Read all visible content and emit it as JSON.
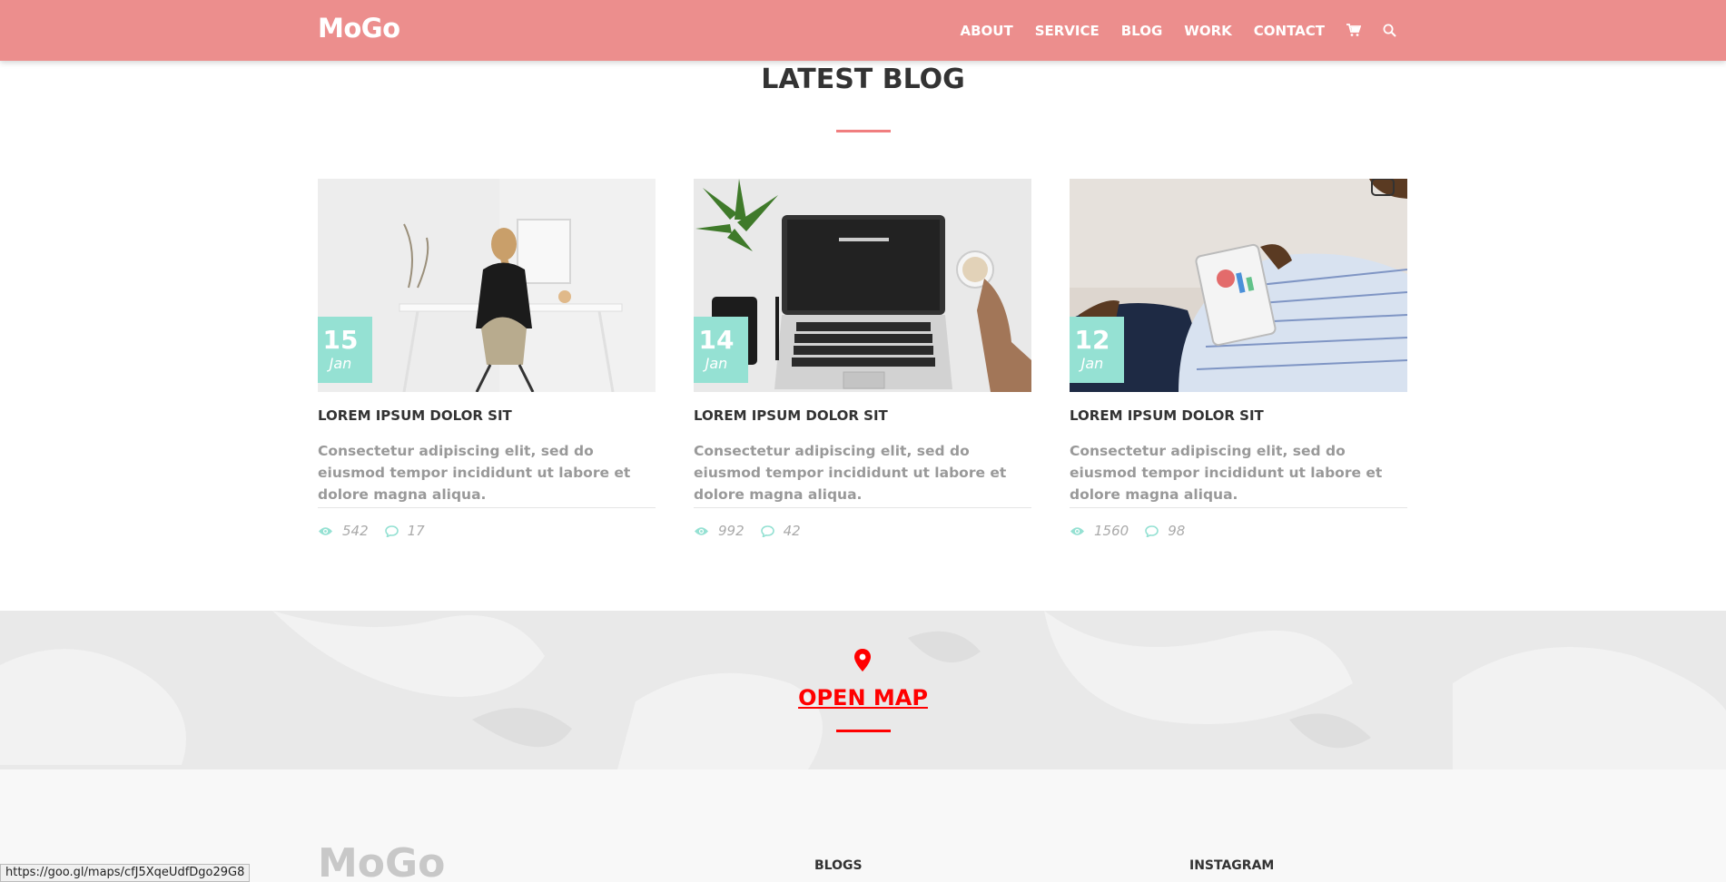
{
  "header": {
    "logo": "MoGo",
    "nav": [
      "ABOUT",
      "SERVICE",
      "BLOG",
      "WORK",
      "CONTACT"
    ],
    "icons": [
      "cart-icon",
      "search-icon"
    ]
  },
  "blog": {
    "title": "LATEST BLOG",
    "posts": [
      {
        "day": "15",
        "month": "Jan",
        "title": "LOREM IPSUM DOLOR SIT",
        "text": "Consectetur adipiscing elit, sed do eiusmod tempor incididunt ut labore et dolore magna aliqua.",
        "views": "542",
        "comments": "17"
      },
      {
        "day": "14",
        "month": "Jan",
        "title": "LOREM IPSUM DOLOR SIT",
        "text": "Consectetur adipiscing elit, sed do eiusmod tempor incididunt ut labore et dolore magna aliqua.",
        "views": "992",
        "comments": "42"
      },
      {
        "day": "12",
        "month": "Jan",
        "title": "LOREM IPSUM DOLOR SIT",
        "text": "Consectetur adipiscing elit, sed do eiusmod tempor incididunt ut labore et dolore magna aliqua.",
        "views": "1560",
        "comments": "98"
      }
    ]
  },
  "map": {
    "link": "OPEN MAP"
  },
  "footer": {
    "logo": "MoGo",
    "blogs": "BLOGS",
    "instagram": "INSTAGRAM"
  },
  "status_url": "https://goo.gl/maps/cfJ5XqeUdfDgo29G8",
  "colors": {
    "header": "#ec8e8d",
    "accent": "#95e1d3",
    "map_link": "#ff0000",
    "rule": "#f07e7f"
  }
}
